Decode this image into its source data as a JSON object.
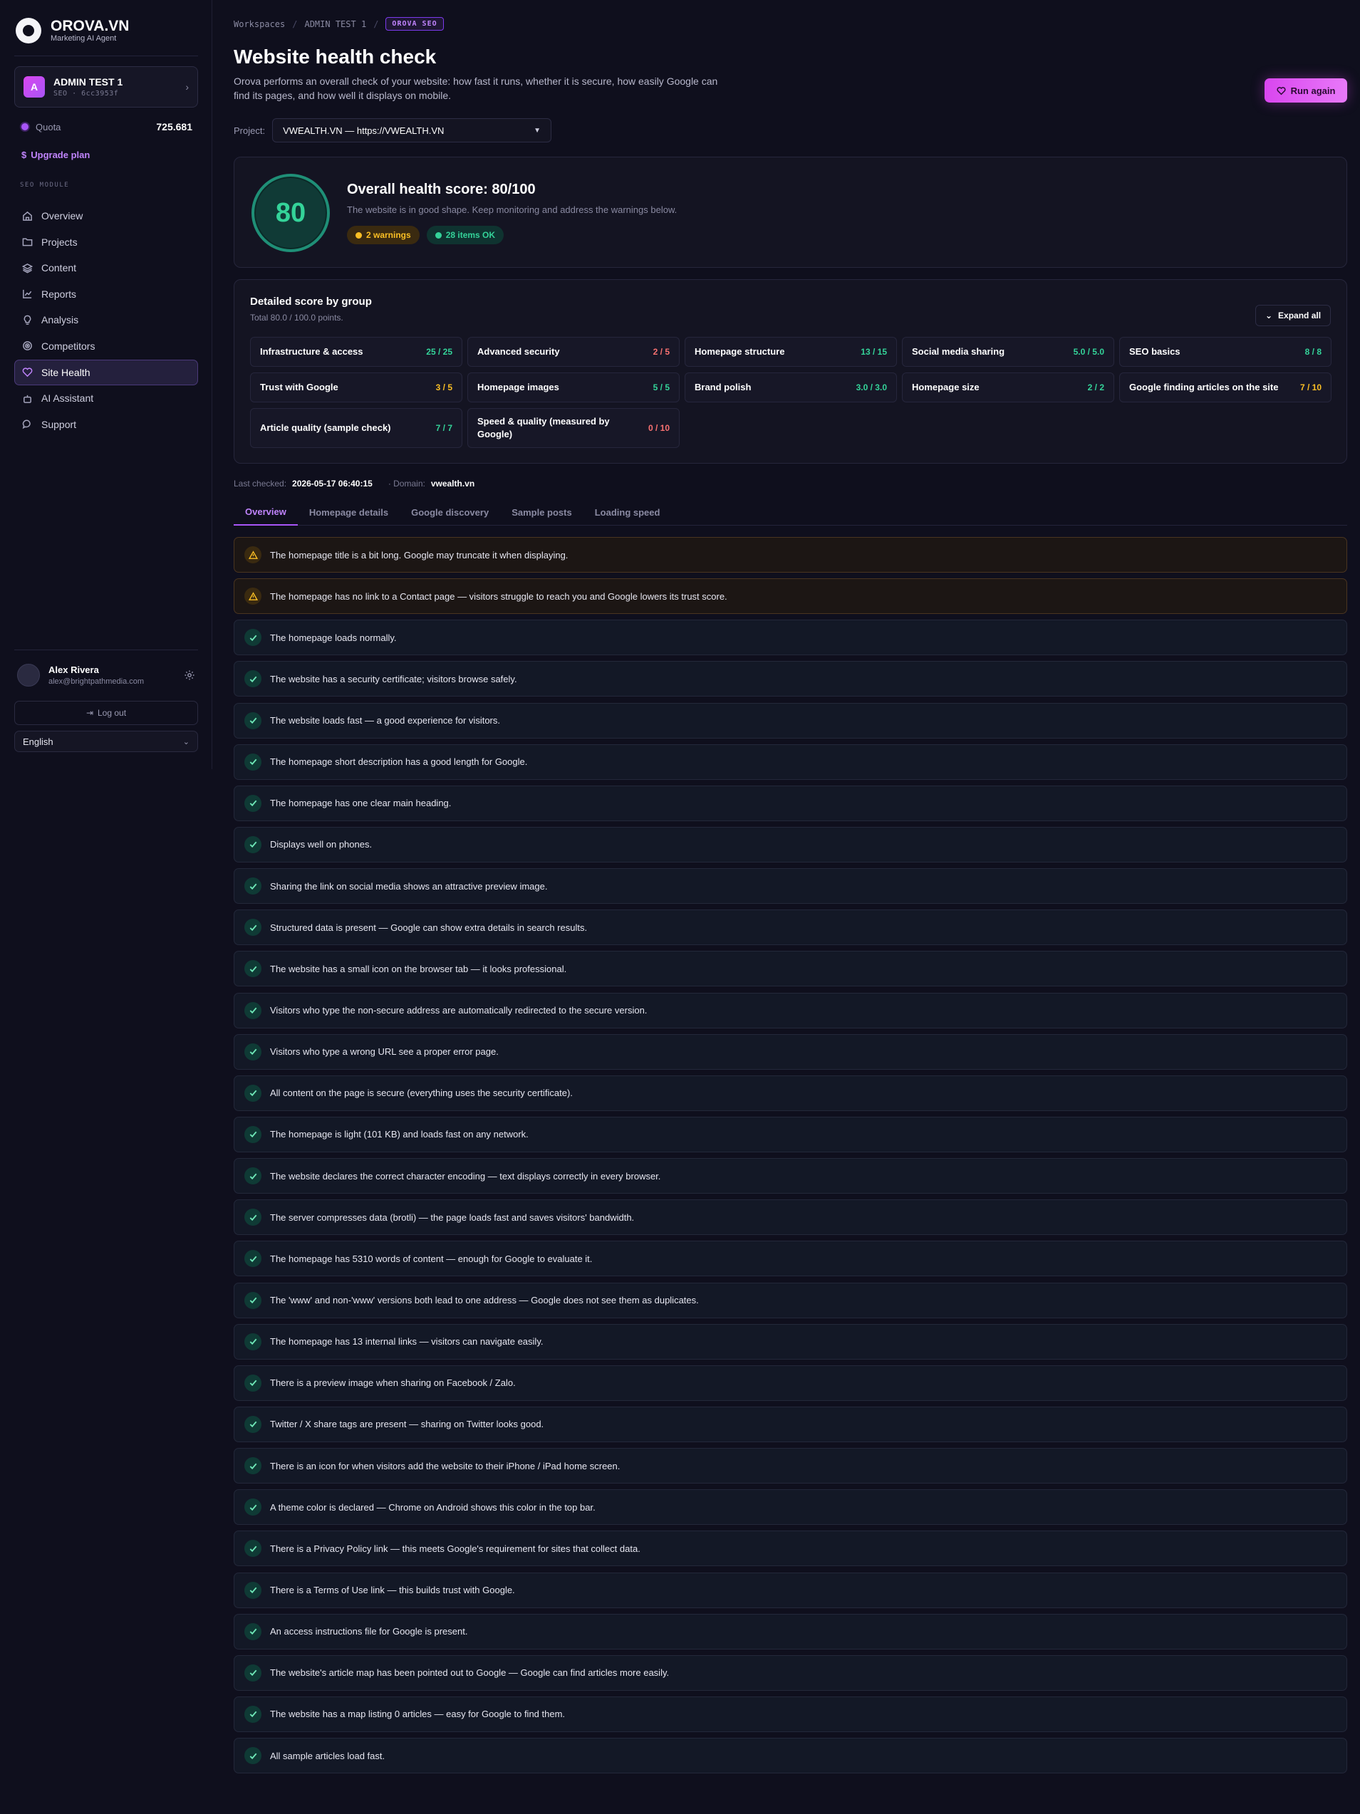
{
  "brand": {
    "name": "OROVA.VN",
    "subtitle": "Marketing AI Agent"
  },
  "workspace": {
    "avatar": "A",
    "name": "ADMIN TEST 1",
    "meta": "SEO · 6cc3953f"
  },
  "quota": {
    "label": "Quota",
    "value": "725.681"
  },
  "upgrade_label": "Upgrade plan",
  "section_label": "SEO MODULE",
  "nav": [
    {
      "label": "Overview",
      "icon": "home-icon"
    },
    {
      "label": "Projects",
      "icon": "folder-icon"
    },
    {
      "label": "Content",
      "icon": "layers-icon"
    },
    {
      "label": "Reports",
      "icon": "chart-icon"
    },
    {
      "label": "Analysis",
      "icon": "bulb-icon"
    },
    {
      "label": "Competitors",
      "icon": "target-icon"
    },
    {
      "label": "Site Health",
      "icon": "heart-icon",
      "active": true
    },
    {
      "label": "AI Assistant",
      "icon": "robot-icon"
    },
    {
      "label": "Support",
      "icon": "chat-icon"
    }
  ],
  "user": {
    "name": "Alex Rivera",
    "email": "alex@brightpathmedia.com"
  },
  "logout_label": "Log out",
  "language": "English",
  "breadcrumb": {
    "items": [
      "Workspaces",
      "ADMIN TEST 1"
    ],
    "badge": "OROVA SEO"
  },
  "page": {
    "title": "Website health check",
    "description": "Orova performs an overall check of your website: how fast it runs, whether it is secure, how easily Google can find its pages, and how well it displays on mobile.",
    "run_again": "Run again"
  },
  "project": {
    "label": "Project:",
    "value": "VWEALTH.VN — https://VWEALTH.VN"
  },
  "score": {
    "value": "80",
    "title": "Overall health score: 80/100",
    "subtitle": "The website is in good shape. Keep monitoring and address the warnings below.",
    "warnings": "2 warnings",
    "ok": "28 items OK"
  },
  "groups": {
    "title": "Detailed score by group",
    "subtitle": "Total 80.0 / 100.0 points.",
    "expand": "Expand all",
    "items": [
      {
        "name": "Infrastructure & access",
        "score": "25 / 25",
        "status": "green"
      },
      {
        "name": "Advanced security",
        "score": "2 / 5",
        "status": "red"
      },
      {
        "name": "Homepage structure",
        "score": "13 / 15",
        "status": "green"
      },
      {
        "name": "Social media sharing",
        "score": "5.0 / 5.0",
        "status": "green"
      },
      {
        "name": "SEO basics",
        "score": "8 / 8",
        "status": "green"
      },
      {
        "name": "Trust with Google",
        "score": "3 / 5",
        "status": "amber"
      },
      {
        "name": "Homepage images",
        "score": "5 / 5",
        "status": "green"
      },
      {
        "name": "Brand polish",
        "score": "3.0 / 3.0",
        "status": "green"
      },
      {
        "name": "Homepage size",
        "score": "2 / 2",
        "status": "green"
      },
      {
        "name": "Google finding articles on the site",
        "score": "7 / 10",
        "status": "amber"
      },
      {
        "name": "Article quality (sample check)",
        "score": "7 / 7",
        "status": "green"
      },
      {
        "name": "Speed & quality (measured by Google)",
        "score": "0 / 10",
        "status": "red"
      }
    ]
  },
  "meta": {
    "checked_label": "Last checked:",
    "checked": "2026-05-17 06:40:15",
    "domain_label": "· Domain:",
    "domain": "vwealth.vn"
  },
  "tabs": [
    "Overview",
    "Homepage details",
    "Google discovery",
    "Sample posts",
    "Loading speed"
  ],
  "checks": [
    {
      "type": "warn",
      "text": "The homepage title is a bit long. Google may truncate it when displaying."
    },
    {
      "type": "warn",
      "text": "The homepage has no link to a Contact page — visitors struggle to reach you and Google lowers its trust score."
    },
    {
      "type": "ok",
      "text": "The homepage loads normally."
    },
    {
      "type": "ok",
      "text": "The website has a security certificate; visitors browse safely."
    },
    {
      "type": "ok",
      "text": "The website loads fast — a good experience for visitors."
    },
    {
      "type": "ok",
      "text": "The homepage short description has a good length for Google."
    },
    {
      "type": "ok",
      "text": "The homepage has one clear main heading."
    },
    {
      "type": "ok",
      "text": "Displays well on phones."
    },
    {
      "type": "ok",
      "text": "Sharing the link on social media shows an attractive preview image."
    },
    {
      "type": "ok",
      "text": "Structured data is present — Google can show extra details in search results."
    },
    {
      "type": "ok",
      "text": "The website has a small icon on the browser tab — it looks professional."
    },
    {
      "type": "ok",
      "text": "Visitors who type the non-secure address are automatically redirected to the secure version."
    },
    {
      "type": "ok",
      "text": "Visitors who type a wrong URL see a proper error page."
    },
    {
      "type": "ok",
      "text": "All content on the page is secure (everything uses the security certificate)."
    },
    {
      "type": "ok",
      "text": "The homepage is light (101 KB) and loads fast on any network."
    },
    {
      "type": "ok",
      "text": "The website declares the correct character encoding — text displays correctly in every browser."
    },
    {
      "type": "ok",
      "text": "The server compresses data (brotli) — the page loads fast and saves visitors' bandwidth."
    },
    {
      "type": "ok",
      "text": "The homepage has 5310 words of content — enough for Google to evaluate it."
    },
    {
      "type": "ok",
      "text": "The 'www' and non-'www' versions both lead to one address — Google does not see them as duplicates."
    },
    {
      "type": "ok",
      "text": "The homepage has 13 internal links — visitors can navigate easily."
    },
    {
      "type": "ok",
      "text": "There is a preview image when sharing on Facebook / Zalo."
    },
    {
      "type": "ok",
      "text": "Twitter / X share tags are present — sharing on Twitter looks good."
    },
    {
      "type": "ok",
      "text": "There is an icon for when visitors add the website to their iPhone / iPad home screen."
    },
    {
      "type": "ok",
      "text": "A theme color is declared — Chrome on Android shows this color in the top bar."
    },
    {
      "type": "ok",
      "text": "There is a Privacy Policy link — this meets Google's requirement for sites that collect data."
    },
    {
      "type": "ok",
      "text": "There is a Terms of Use link — this builds trust with Google."
    },
    {
      "type": "ok",
      "text": "An access instructions file for Google is present."
    },
    {
      "type": "ok",
      "text": "The website's article map has been pointed out to Google — Google can find articles more easily."
    },
    {
      "type": "ok",
      "text": "The website has a map listing 0 articles — easy for Google to find them."
    },
    {
      "type": "ok",
      "text": "All sample articles load fast."
    }
  ]
}
